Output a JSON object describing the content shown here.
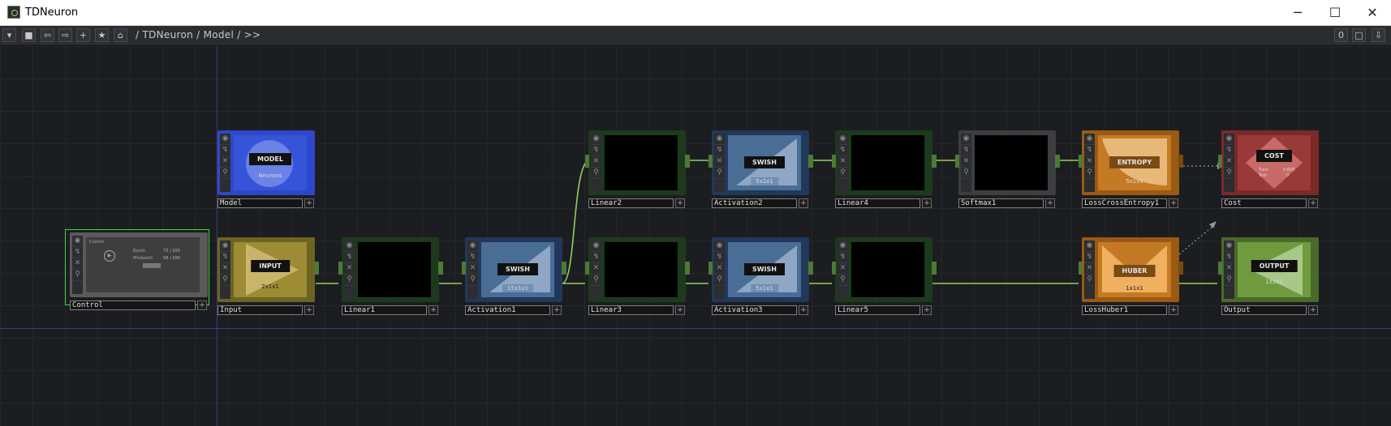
{
  "window": {
    "title": "TDNeuron",
    "minimize": "─",
    "maximize": "☐",
    "close": "✕"
  },
  "toolbar": {
    "breadcrumb": "/ TDNeuron / Model / >>",
    "right_indicator": "0"
  },
  "nodes": {
    "model": {
      "label": "Model",
      "tag": "MODEL",
      "sub": "Neurons"
    },
    "control": {
      "label": "Control",
      "panel_title": "Control",
      "row1_label": "Epoch",
      "row1_value": "73 / 100",
      "row2_label": "Minibatch",
      "row2_value": "58 / 100"
    },
    "input": {
      "label": "Input",
      "tag": "INPUT",
      "sub": "2x1x1"
    },
    "linear1": {
      "label": "Linear1"
    },
    "activation1": {
      "label": "Activation1",
      "tag": "SWISH",
      "sub": "15x1x1"
    },
    "linear2": {
      "label": "Linear2"
    },
    "linear3": {
      "label": "Linear3"
    },
    "activation2": {
      "label": "Activation2",
      "tag": "SWISH",
      "sub": "5x1x1"
    },
    "activation3": {
      "label": "Activation3",
      "tag": "SWISH",
      "sub": "5x1x1"
    },
    "linear4": {
      "label": "Linear4"
    },
    "linear5": {
      "label": "Linear5"
    },
    "softmax1": {
      "label": "Softmax1"
    },
    "losscrossentropy1": {
      "label": "LossCrossEntropy1",
      "tag": "ENTROPY",
      "sub": "5x1x1"
    },
    "losshuber1": {
      "label": "LossHuber1",
      "tag": "HUBER",
      "sub": "1x1x1"
    },
    "cost": {
      "label": "Cost",
      "tag": "COST",
      "row1_label": "Train",
      "row1_value": "0.605",
      "row2_label": "Test",
      "row2_value": "0"
    },
    "output": {
      "label": "Output",
      "tag": "OUTPUT",
      "sub": "1x1x1"
    }
  },
  "colors": {
    "wire": "#8fd060",
    "wire_dotted": "#8a9aa8",
    "selection": "#3cdc3c"
  }
}
